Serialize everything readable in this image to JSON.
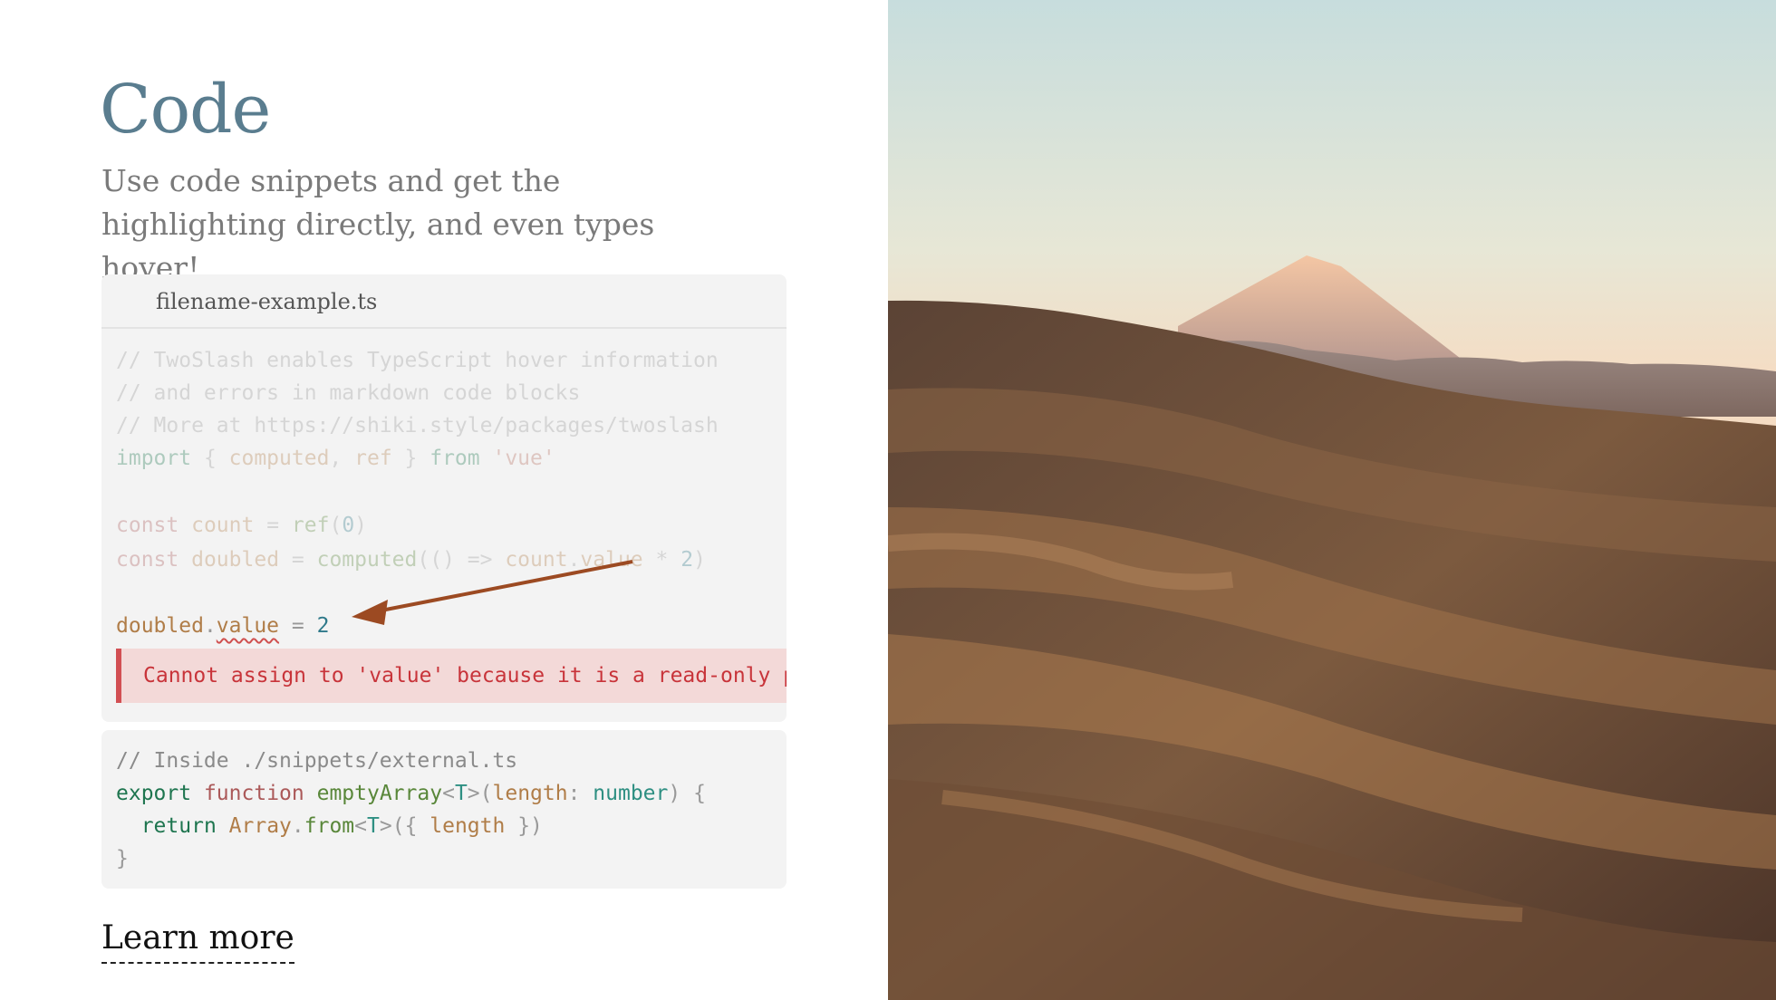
{
  "page": {
    "title": "Code",
    "subtitle": "Use code snippets and get the highlighting directly, and even types hover!"
  },
  "code_card": {
    "filename": "filename-example.ts",
    "lines": [
      "// TwoSlash enables TypeScript hover information",
      "// and errors in markdown code blocks",
      "// More at https://shiki.style/packages/twoslash",
      "import { computed, ref } from 'vue'",
      "",
      "const count = ref(0)",
      "const doubled = computed(() => count.value * 2)",
      "",
      "doubled.value = 2"
    ],
    "error_message": "Cannot assign to 'value' because it is a read-only property."
  },
  "snippet": {
    "lines": [
      "// Inside ./snippets/external.ts",
      "export function emptyArray<T>(length: number) {",
      "  return Array.from<T>({ length })",
      "}"
    ]
  },
  "link": {
    "label": "Learn more"
  },
  "colors": {
    "title": "#5a7d8f",
    "subtitle": "#7a7a7a",
    "error": "#c8343a",
    "arrow": "#9c4a22"
  },
  "photo": {
    "subject": "mountain-landscape-image"
  }
}
